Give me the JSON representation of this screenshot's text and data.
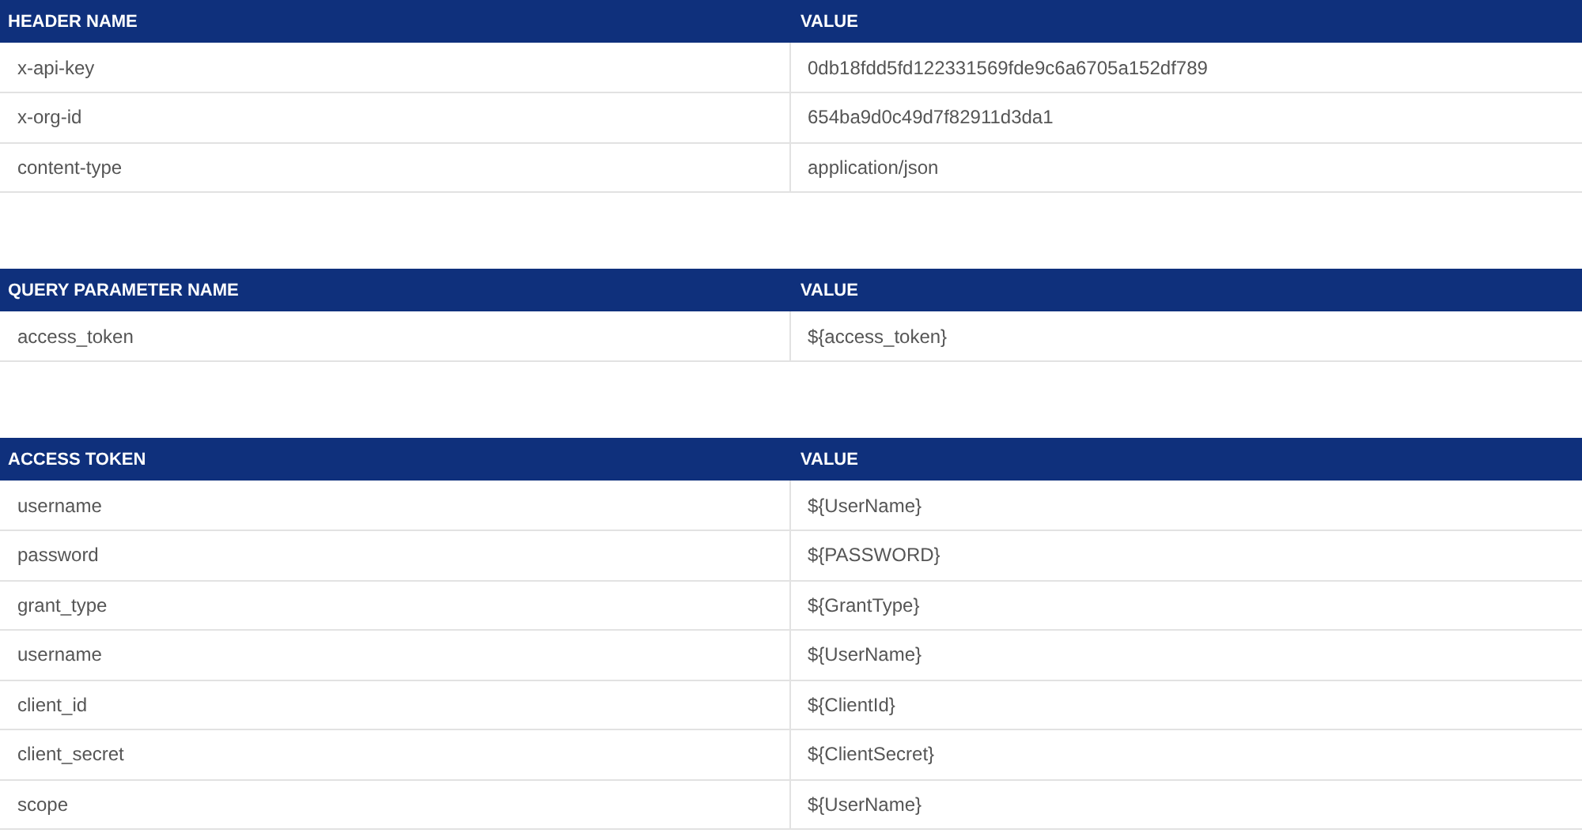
{
  "tables": [
    {
      "columns": [
        "HEADER NAME",
        "VALUE"
      ],
      "rows": [
        [
          "x-api-key",
          "0db18fdd5fd122331569fde9c6a6705a152df789"
        ],
        [
          "x-org-id",
          "654ba9d0c49d7f82911d3da1"
        ],
        [
          "content-type",
          "application/json"
        ]
      ]
    },
    {
      "columns": [
        "QUERY PARAMETER NAME",
        "VALUE"
      ],
      "rows": [
        [
          "access_token",
          "${access_token}"
        ]
      ]
    },
    {
      "columns": [
        "ACCESS TOKEN",
        "VALUE"
      ],
      "rows": [
        [
          "username",
          "${UserName}"
        ],
        [
          "password",
          "${PASSWORD}"
        ],
        [
          "grant_type",
          "${GrantType}"
        ],
        [
          "username",
          "${UserName}"
        ],
        [
          "client_id",
          "${ClientId}"
        ],
        [
          "client_secret",
          "${ClientSecret}"
        ],
        [
          "scope",
          "${UserName}"
        ]
      ]
    }
  ]
}
